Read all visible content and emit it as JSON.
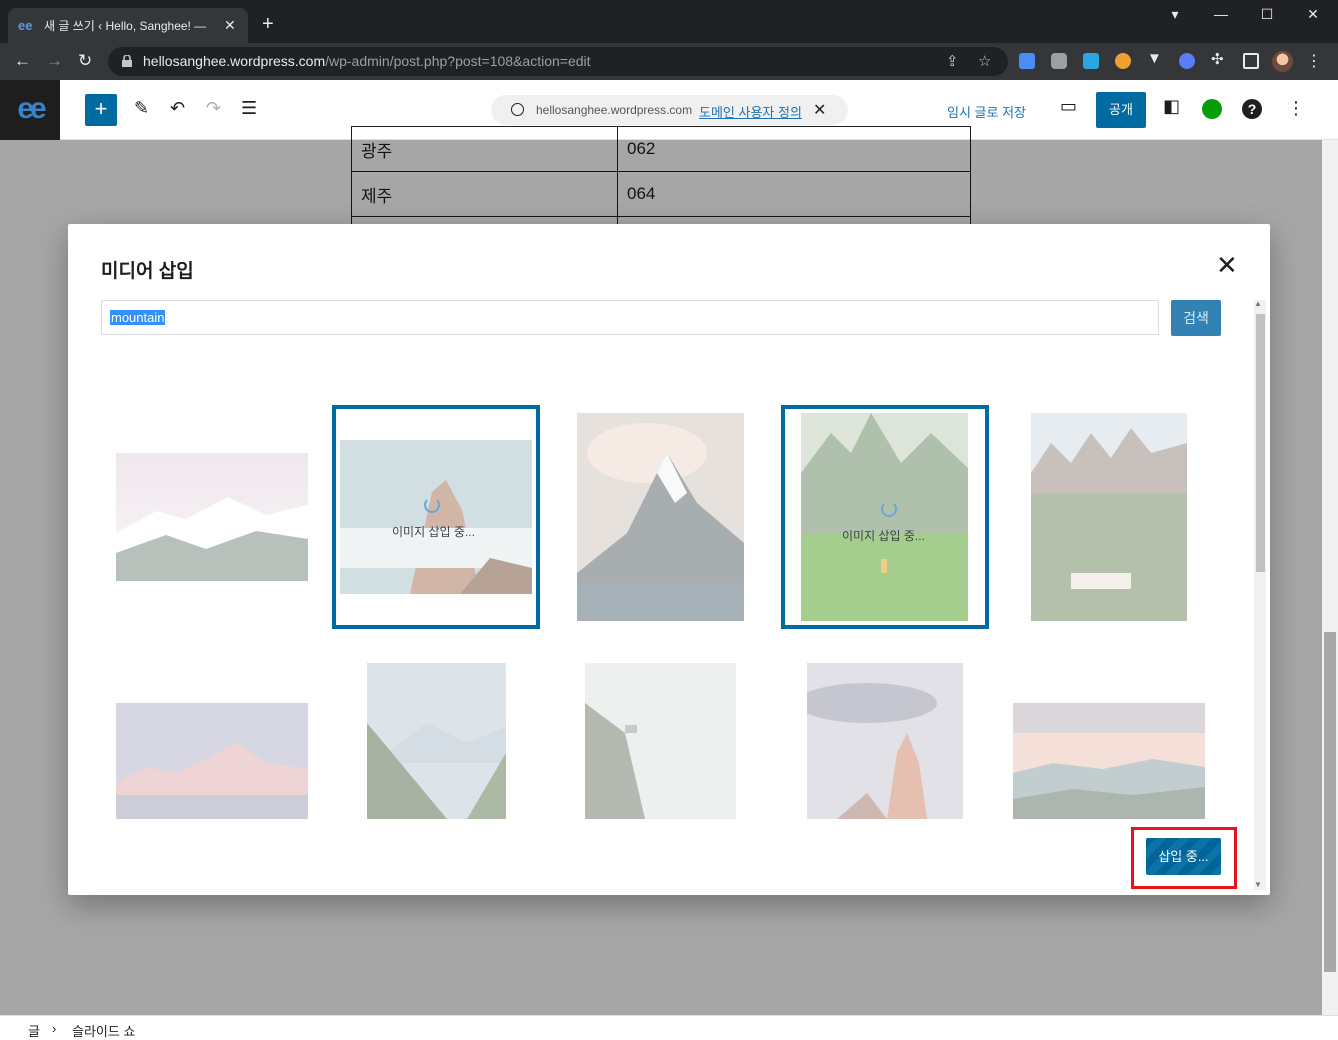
{
  "browser": {
    "tab_title": "새 글 쓰기 ‹ Hello, Sanghee! —",
    "tab_favicon": "ee",
    "url_domain": "hellosanghee.wordpress.com",
    "url_path": "/wp-admin/post.php?post=108&action=edit",
    "window_controls": [
      "▾",
      "—",
      "☐",
      "✕"
    ]
  },
  "editor_header": {
    "logo": "ee",
    "add_block": "+",
    "domain_text": "hellosanghee.wordpress.com",
    "domain_link": "도메인 사용자 정의",
    "domain_close": "✕",
    "save_draft": "임시 글로 저장",
    "publish": "공개",
    "help": "?",
    "more": "⋮"
  },
  "post_table": {
    "rows": [
      [
        "광주",
        "062"
      ],
      [
        "제주",
        "064"
      ],
      [
        "",
        ""
      ]
    ]
  },
  "modal": {
    "title": "미디어 삽입",
    "close": "✕",
    "search_value": "mountain",
    "search_button": "검색",
    "inserting_label": "이미지 삽입 중...",
    "insert_button": "삽입 중...",
    "images": [
      {
        "name": "snowy-range",
        "selected": false
      },
      {
        "name": "rocky-peak-clouds",
        "selected": true
      },
      {
        "name": "matterhorn",
        "selected": false
      },
      {
        "name": "green-valley-person",
        "selected": true
      },
      {
        "name": "dolomites-village",
        "selected": false
      },
      {
        "name": "pink-mountains",
        "selected": false
      },
      {
        "name": "forest-valley",
        "selected": false
      },
      {
        "name": "foggy-cliff",
        "selected": false
      },
      {
        "name": "rock-spire",
        "selected": false
      },
      {
        "name": "sunset-hills",
        "selected": false
      }
    ]
  },
  "footer": {
    "crumb_root": "글",
    "crumb_sep": "›",
    "crumb_current": "슬라이드 쇼"
  },
  "colors": {
    "accent": "#006ba1",
    "highlight": "#e8141c"
  }
}
